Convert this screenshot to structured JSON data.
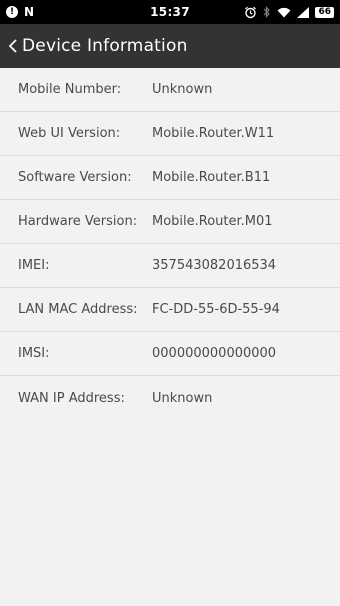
{
  "status_bar": {
    "left_icon_1": "!",
    "left_icon_2": "N",
    "time": "15:37",
    "battery": "66",
    "icons": [
      "alarm-icon",
      "bluetooth-icon",
      "wifi-icon",
      "signal-icon"
    ]
  },
  "app_bar": {
    "back_icon": "chevron-left-icon",
    "title": "Device Information"
  },
  "rows": [
    {
      "label": "Mobile Number:",
      "value": "Unknown"
    },
    {
      "label": "Web UI Version:",
      "value": "Mobile.Router.W11"
    },
    {
      "label": "Software Version:",
      "value": "Mobile.Router.B11"
    },
    {
      "label": "Hardware Version:",
      "value": "Mobile.Router.M01"
    },
    {
      "label": "IMEI:",
      "value": "357543082016534"
    },
    {
      "label": "LAN MAC Address:",
      "value": "FC-DD-55-6D-55-94"
    },
    {
      "label": "IMSI:",
      "value": "000000000000000"
    },
    {
      "label": "WAN IP Address:",
      "value": "Unknown"
    }
  ]
}
